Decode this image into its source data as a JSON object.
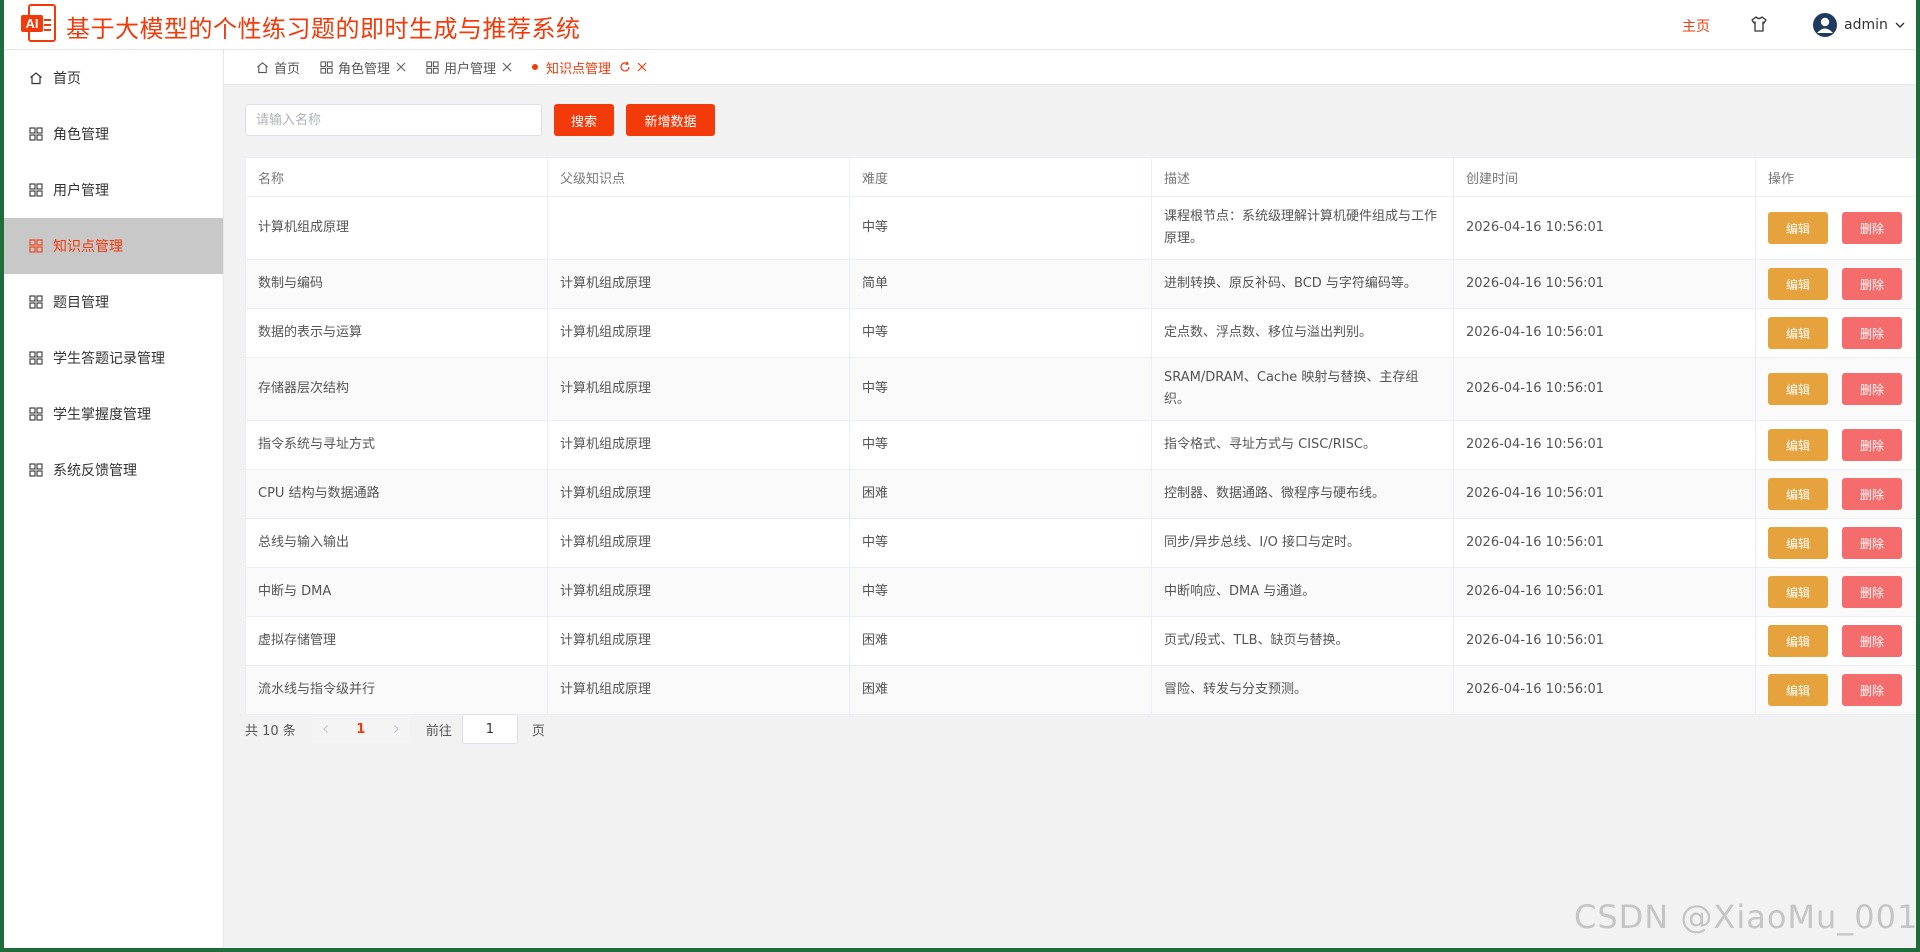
{
  "header": {
    "logo_text": "AI",
    "title": "基于大模型的个性练习题的即时生成与推荐系统",
    "nav_home": "主页",
    "username": "admin",
    "brand_color": "#f33a0b"
  },
  "sidebar": {
    "items": [
      {
        "label": "首页",
        "icon": "home-icon"
      },
      {
        "label": "角色管理",
        "icon": "grid-icon"
      },
      {
        "label": "用户管理",
        "icon": "grid-icon"
      },
      {
        "label": "知识点管理",
        "icon": "grid-icon",
        "active": true
      },
      {
        "label": "题目管理",
        "icon": "grid-icon"
      },
      {
        "label": "学生答题记录管理",
        "icon": "grid-icon"
      },
      {
        "label": "学生掌握度管理",
        "icon": "grid-icon"
      },
      {
        "label": "系统反馈管理",
        "icon": "grid-icon"
      }
    ]
  },
  "tabs": [
    {
      "label": "首页"
    },
    {
      "label": "角色管理"
    },
    {
      "label": "用户管理"
    },
    {
      "label": "知识点管理",
      "active": true
    }
  ],
  "toolbar": {
    "search_placeholder": "请输入名称",
    "search_label": "搜索",
    "add_label": "新增数据"
  },
  "table": {
    "columns": [
      "名称",
      "父级知识点",
      "难度",
      "描述",
      "创建时间",
      "操作"
    ],
    "edit_label": "编辑",
    "delete_label": "删除",
    "rows": [
      {
        "name": "计算机组成原理",
        "parent": "",
        "difficulty": "中等",
        "desc": "课程根节点：系统级理解计算机硬件组成与工作原理。",
        "created": "2026-04-16 10:56:01"
      },
      {
        "name": "数制与编码",
        "parent": "计算机组成原理",
        "difficulty": "简单",
        "desc": "进制转换、原反补码、BCD 与字符编码等。",
        "created": "2026-04-16 10:56:01"
      },
      {
        "name": "数据的表示与运算",
        "parent": "计算机组成原理",
        "difficulty": "中等",
        "desc": "定点数、浮点数、移位与溢出判别。",
        "created": "2026-04-16 10:56:01"
      },
      {
        "name": "存储器层次结构",
        "parent": "计算机组成原理",
        "difficulty": "中等",
        "desc": "SRAM/DRAM、Cache 映射与替换、主存组织。",
        "created": "2026-04-16 10:56:01"
      },
      {
        "name": "指令系统与寻址方式",
        "parent": "计算机组成原理",
        "difficulty": "中等",
        "desc": "指令格式、寻址方式与 CISC/RISC。",
        "created": "2026-04-16 10:56:01"
      },
      {
        "name": "CPU 结构与数据通路",
        "parent": "计算机组成原理",
        "difficulty": "困难",
        "desc": "控制器、数据通路、微程序与硬布线。",
        "created": "2026-04-16 10:56:01"
      },
      {
        "name": "总线与输入输出",
        "parent": "计算机组成原理",
        "difficulty": "中等",
        "desc": "同步/异步总线、I/O 接口与定时。",
        "created": "2026-04-16 10:56:01"
      },
      {
        "name": "中断与 DMA",
        "parent": "计算机组成原理",
        "difficulty": "中等",
        "desc": "中断响应、DMA 与通道。",
        "created": "2026-04-16 10:56:01"
      },
      {
        "name": "虚拟存储管理",
        "parent": "计算机组成原理",
        "difficulty": "困难",
        "desc": "页式/段式、TLB、缺页与替换。",
        "created": "2026-04-16 10:56:01"
      },
      {
        "name": "流水线与指令级并行",
        "parent": "计算机组成原理",
        "difficulty": "困难",
        "desc": "冒险、转发与分支预测。",
        "created": "2026-04-16 10:56:01"
      }
    ]
  },
  "pagination": {
    "total_text": "共 10 条",
    "current_page": "1",
    "goto_label": "前往",
    "goto_value": "1",
    "page_unit": "页"
  },
  "watermark": "CSDN @XiaoMu_001"
}
